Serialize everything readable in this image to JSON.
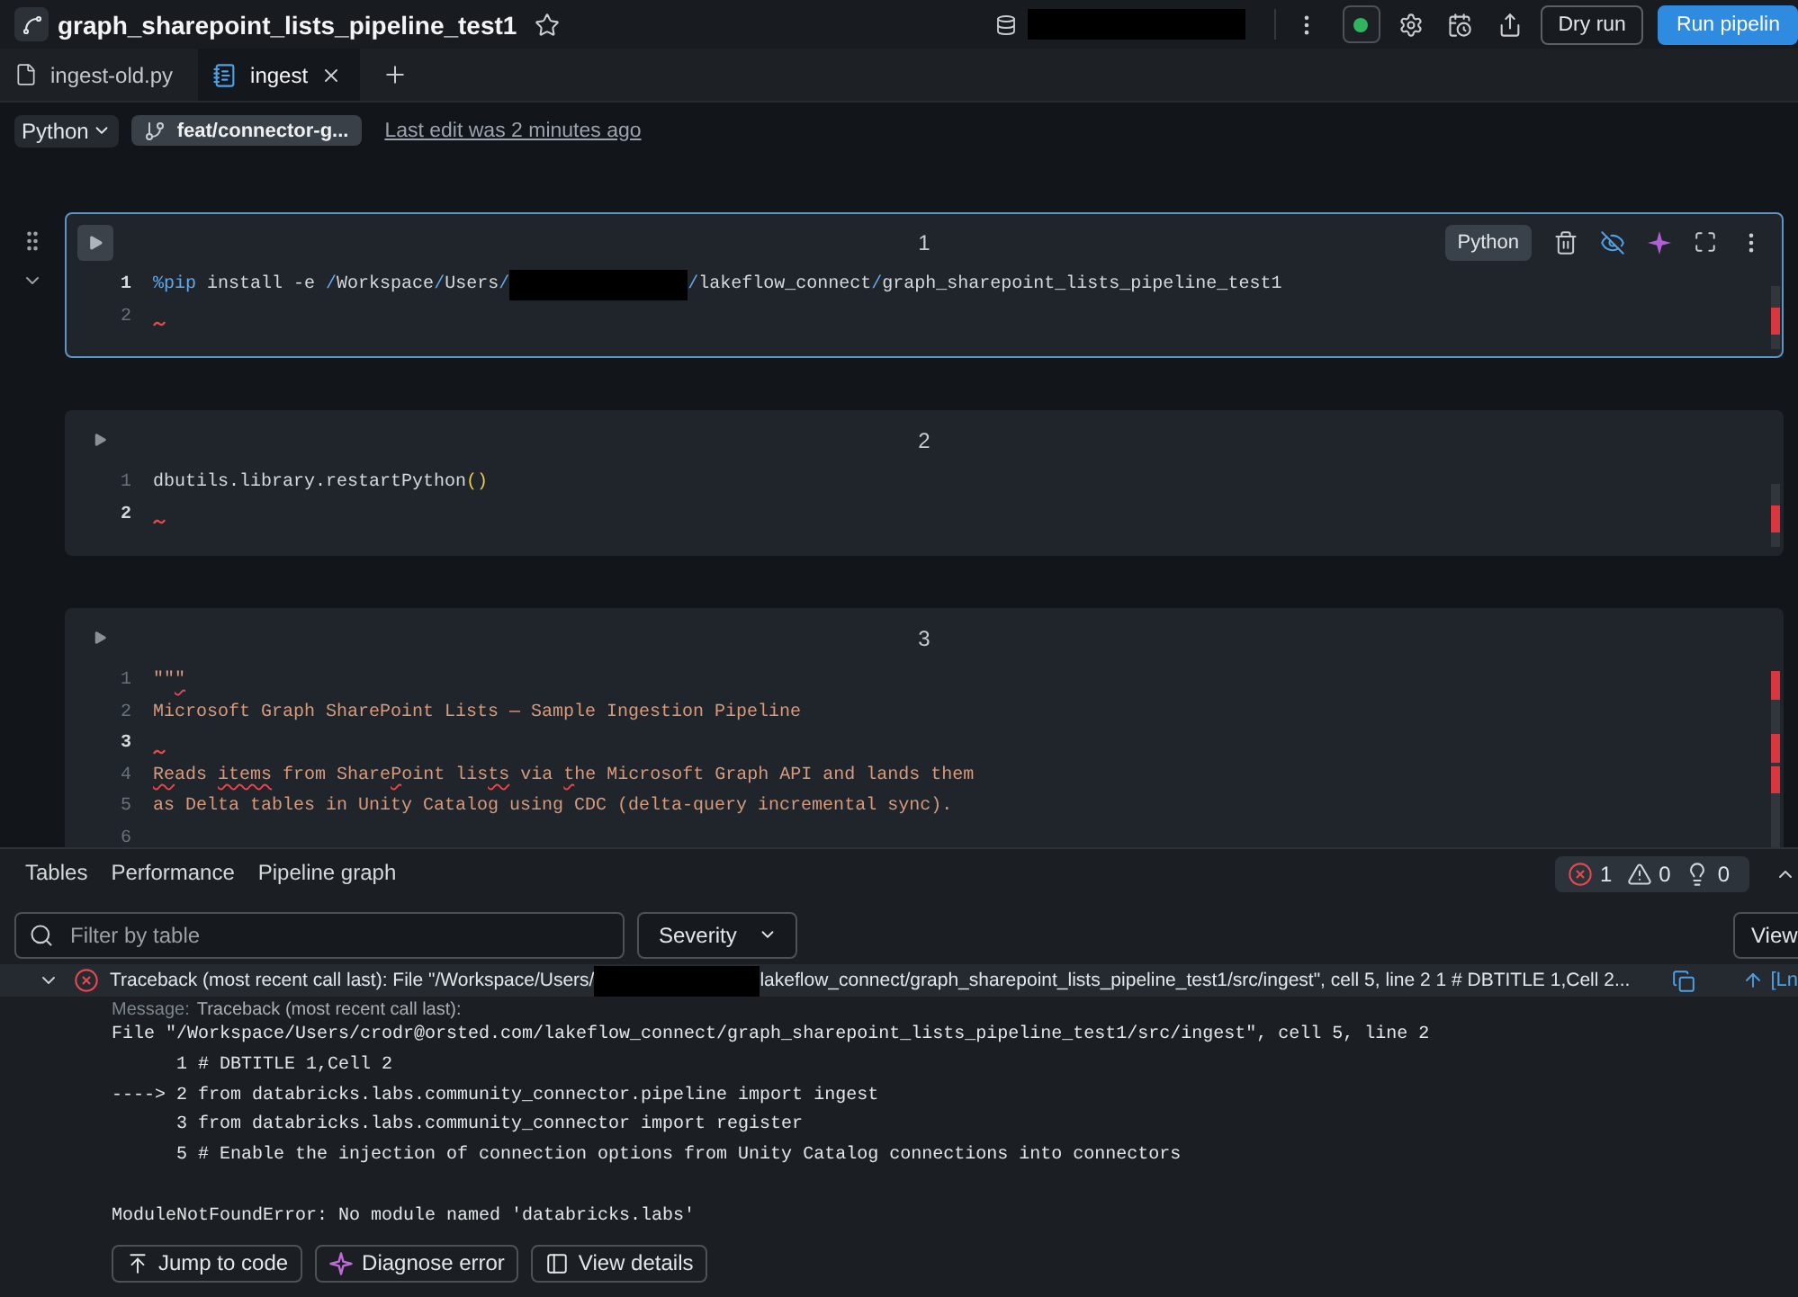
{
  "header": {
    "title": "graph_sharepoint_lists_pipeline_test1",
    "starred": false,
    "buttons": [
      {
        "label": "Dry run",
        "kind": "outline"
      },
      {
        "label": "Run pipelin",
        "kind": "primary"
      }
    ]
  },
  "file_tabs": [
    {
      "label": "ingest-old.py",
      "kind": "file",
      "selected": false
    },
    {
      "label": "ingest",
      "kind": "notebook",
      "selected": true
    }
  ],
  "toolbar": {
    "language": "Python",
    "branch": "feat/connector-g...",
    "last_edit": "Last edit was 2 minutes ago"
  },
  "cells": [
    {
      "number": "1",
      "selected": true,
      "language": "Python",
      "lines": [
        {
          "number": "1",
          "current": true,
          "segments": [
            {
              "kind": "magic",
              "text": "%pip"
            },
            {
              "kind": "plain",
              "text": " install -e "
            },
            {
              "kind": "op",
              "text": "/"
            },
            {
              "kind": "plain",
              "text": "Workspace"
            },
            {
              "kind": "op",
              "text": "/"
            },
            {
              "kind": "plain",
              "text": "Users"
            },
            {
              "kind": "op",
              "text": "/"
            },
            {
              "kind": "redacted"
            },
            {
              "kind": "op",
              "text": "/"
            },
            {
              "kind": "plain",
              "text": "lakeflow_connect"
            },
            {
              "kind": "op",
              "text": "/"
            },
            {
              "kind": "plain",
              "text": "graph_sharepoint_lists_pipeline_test1"
            }
          ]
        },
        {
          "number": "2",
          "current": false,
          "segments": [
            {
              "kind": "squiggle"
            }
          ]
        }
      ]
    },
    {
      "number": "2",
      "selected": false,
      "lines": [
        {
          "number": "1",
          "current": false,
          "segments": [
            {
              "kind": "plain",
              "text": "dbutils.library.restartPython"
            },
            {
              "kind": "paren",
              "text": "()"
            }
          ]
        },
        {
          "number": "2",
          "current": true,
          "segments": [
            {
              "kind": "squiggle"
            }
          ]
        }
      ]
    },
    {
      "number": "3",
      "selected": false,
      "lines": [
        {
          "number": "1",
          "current": false,
          "segments": [
            {
              "kind": "doc",
              "text": "\"\""
            },
            {
              "kind": "misspelled",
              "text": "\""
            }
          ]
        },
        {
          "number": "2",
          "current": false,
          "segments": [
            {
              "kind": "doc",
              "text": "Microsoft Graph SharePoint Lists — Sample Ingestion Pipeline"
            }
          ]
        },
        {
          "number": "3",
          "current": true,
          "segments": [
            {
              "kind": "squiggle"
            }
          ]
        },
        {
          "number": "4",
          "current": false,
          "segments": [
            {
              "kind": "misspelled",
              "text": "Re"
            },
            {
              "kind": "doc",
              "text": "ads "
            },
            {
              "kind": "misspelled",
              "text": "items"
            },
            {
              "kind": "doc",
              "text": " from Share"
            },
            {
              "kind": "misspelled",
              "text": "P"
            },
            {
              "kind": "doc",
              "text": "oint lis"
            },
            {
              "kind": "misspelled",
              "text": "ts"
            },
            {
              "kind": "doc",
              "text": " via "
            },
            {
              "kind": "misspelled",
              "text": "t"
            },
            {
              "kind": "doc",
              "text": "he Microsoft Graph API and lands them"
            }
          ]
        },
        {
          "number": "5",
          "current": false,
          "segments": [
            {
              "kind": "doc",
              "text": "as Delta tables in Unity Catalog using CDC (delta-query incremental sync)."
            }
          ]
        },
        {
          "number": "6",
          "current": false
        }
      ]
    }
  ],
  "bottom_panel": {
    "tabs": [
      {
        "label": "Tables",
        "selected": false
      },
      {
        "label": "Performance",
        "selected": false
      },
      {
        "label": "Pipeline graph",
        "selected": false
      }
    ],
    "issues": [
      {
        "kind": "error",
        "count": "1"
      },
      {
        "kind": "warning",
        "count": "0"
      },
      {
        "kind": "info",
        "count": "0"
      }
    ],
    "filter": {
      "placeholder": "Filter by table"
    },
    "severity": "Severity",
    "view": "View",
    "error": {
      "expanded": true,
      "summary": [
        {
          "kind": "text",
          "text": "Traceback (most recent call last): File \"/Workspace/Users/"
        },
        {
          "kind": "redacted"
        },
        {
          "kind": "text",
          "text": "lakeflow_connect/graph_sharepoint_lists_pipeline_test1/src/ingest\", cell 5, line 2 1 # DBTITLE 1,Cell 2..."
        }
      ],
      "link": "[Ln",
      "message_label": "Message:",
      "message": "Traceback (most recent call last):",
      "trace": [
        "File \"/Workspace/Users/crodr@orsted.com/lakeflow_connect/graph_sharepoint_lists_pipeline_test1/src/ingest\", cell 5, line 2",
        "      1 # DBTITLE 1,Cell 2",
        "----> 2 from databricks.labs.community_connector.pipeline import ingest",
        "      3 from databricks.labs.community_connector import register",
        "      5 # Enable the injection of connection options from Unity Catalog connections into connectors"
      ],
      "exception": "ModuleNotFoundError: No module named 'databricks.labs'",
      "actions": [
        {
          "label": "Jump to code",
          "kind": "jump"
        },
        {
          "label": "Diagnose error",
          "kind": "diagnose"
        },
        {
          "label": "View details",
          "kind": "details"
        }
      ]
    }
  }
}
